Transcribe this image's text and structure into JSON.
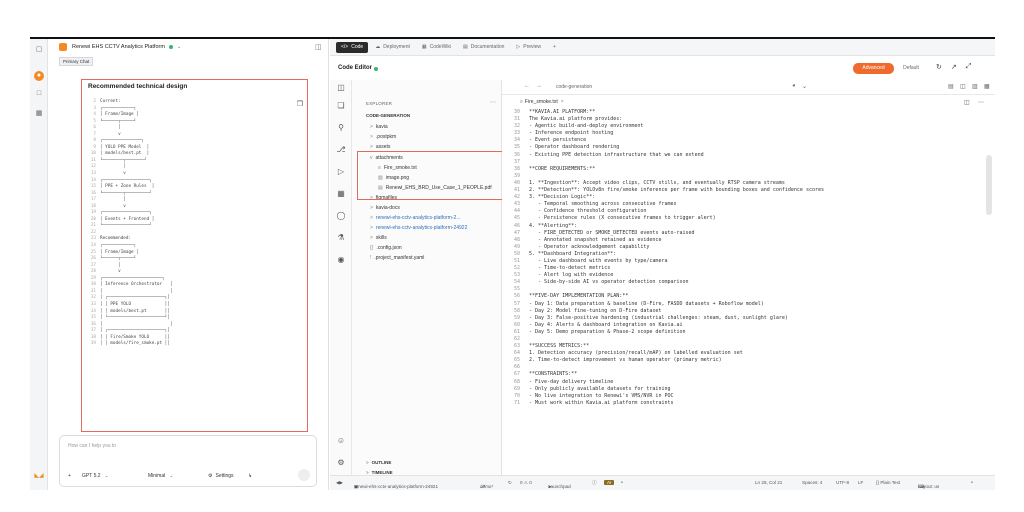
{
  "app": {
    "project_title": "Renewi EHS CCTV Analytics Platform",
    "accent": "#f28b24",
    "status_color": "#3cb371",
    "highlight_border": "#e36b5e"
  },
  "rail": {
    "icons": [
      "box-icon",
      "orange-circle-icon",
      "chat-icon",
      "grid-icon"
    ],
    "brand_glyph": "◣◢"
  },
  "chat": {
    "active_tab": "Primary Chat",
    "doc_title": "Recommended technical design",
    "doc_lines": [
      {
        "n": "2",
        "t": "Current:"
      },
      {
        "n": "3",
        "t": "┌────────────┐"
      },
      {
        "n": "4",
        "t": "│ Frame/Image │"
      },
      {
        "n": "5",
        "t": "└──────┬─────┘"
      },
      {
        "n": "6",
        "t": "       │"
      },
      {
        "n": "7",
        "t": "       v"
      },
      {
        "n": "8",
        "t": "┌───────────────┐"
      },
      {
        "n": "9",
        "t": "│ YOLO PPE Model  │"
      },
      {
        "n": "10",
        "t": "│ models/best.pt  │"
      },
      {
        "n": "11",
        "t": "└────────┬───────┘"
      },
      {
        "n": "12",
        "t": "         │"
      },
      {
        "n": "13",
        "t": "         v"
      },
      {
        "n": "14",
        "t": "┌──────────────────┐"
      },
      {
        "n": "15",
        "t": "│ PPE + Zone Rules  │"
      },
      {
        "n": "16",
        "t": "└────────┬─────────┘"
      },
      {
        "n": "17",
        "t": "         │"
      },
      {
        "n": "18",
        "t": "         v"
      },
      {
        "n": "19",
        "t": "┌──────────────────┐"
      },
      {
        "n": "20",
        "t": "│ Events + Frontend │"
      },
      {
        "n": "21",
        "t": "└──────────────────┘"
      },
      {
        "n": "22",
        "t": ""
      },
      {
        "n": "23",
        "t": "Recommended:"
      },
      {
        "n": "24",
        "t": "┌────────────┐"
      },
      {
        "n": "25",
        "t": "│ Frame/Image │"
      },
      {
        "n": "26",
        "t": "└──────┬─────┘"
      },
      {
        "n": "27",
        "t": "       │"
      },
      {
        "n": "28",
        "t": "       v"
      },
      {
        "n": "29",
        "t": "┌───────────────────────┐"
      },
      {
        "n": "30",
        "t": "│ Inference Orchestrator   │"
      },
      {
        "n": "31",
        "t": "│                          │"
      },
      {
        "n": "32",
        "t": "│ ┌──────────────────────┐│"
      },
      {
        "n": "33",
        "t": "│ │ PPE YOLO             ││"
      },
      {
        "n": "34",
        "t": "│ │ models/best.pt       ││"
      },
      {
        "n": "35",
        "t": "│ └──────────────────────┘│"
      },
      {
        "n": "36",
        "t": "│                          │"
      },
      {
        "n": "37",
        "t": "│ ┌──────────────────────┐│"
      },
      {
        "n": "38",
        "t": "│ │ Fire/Smoke YOLO      ││"
      },
      {
        "n": "39",
        "t": "│ │ models/fire_smoke.pt ││"
      }
    ],
    "input_placeholder": "How can I help you to",
    "model": "GPT 5.2",
    "mode": "Minimal",
    "settings_label": "Settings"
  },
  "tabs": [
    {
      "icon": "</>",
      "label": "Code",
      "active": true
    },
    {
      "icon": "☁",
      "label": "Deployment",
      "active": false
    },
    {
      "icon": "▦",
      "label": "CodeWiki",
      "active": false
    },
    {
      "icon": "▤",
      "label": "Documentation",
      "active": false
    },
    {
      "icon": "▷",
      "label": "Preview",
      "active": false
    },
    {
      "icon": "",
      "label": "+",
      "active": false
    }
  ],
  "editor": {
    "title": "Code Editor",
    "advanced_label": "Advanced",
    "default_label": "Default",
    "path": "code-generation"
  },
  "explorer": {
    "header": "EXPLORER",
    "root": "CODE-GENERATION",
    "items": [
      {
        "chev": ">",
        "label": "kavia",
        "indent": 0
      },
      {
        "chev": ">",
        "label": ".postpkm",
        "indent": 0
      },
      {
        "chev": ">",
        "label": "assets",
        "indent": 0
      },
      {
        "chev": "v",
        "label": "attachments",
        "indent": 0
      },
      {
        "chev": "≡",
        "label": "Fire_smoke.txt",
        "indent": 1
      },
      {
        "chev": "▧",
        "label": "image.png",
        "indent": 1
      },
      {
        "chev": "▤",
        "label": "Renewi_EHS_BRD_Use_Case_1_PEOPLE.pdf",
        "indent": 1
      },
      {
        "chev": ">",
        "label": "figmafiles",
        "indent": 0
      },
      {
        "chev": ">",
        "label": "kavia-docs",
        "indent": 0
      },
      {
        "chev": ">",
        "label": "renewi-ehs-cctv-analytics-platform-2...",
        "indent": 0
      },
      {
        "chev": ">",
        "label": "renewi-ehs-cctv-analytics-platform-24922",
        "indent": 0
      },
      {
        "chev": ">",
        "label": "skills",
        "indent": 0
      },
      {
        "chev": "{}",
        "label": ".config.json",
        "indent": 0
      },
      {
        "chev": "!",
        "label": ".project_manifest.yaml",
        "indent": 0
      }
    ],
    "outline_label": "OUTLINE",
    "timeline_label": "TIMELINE"
  },
  "code_file": {
    "name": "Fire_smoke.txt",
    "lines": [
      {
        "n": "30",
        "t": "**KAVIA.AI PLATFORM:**"
      },
      {
        "n": "31",
        "t": "The Kavia.ai platform provides:"
      },
      {
        "n": "32",
        "t": "- Agentic build-and-deploy environment"
      },
      {
        "n": "33",
        "t": "- Inference endpoint hosting"
      },
      {
        "n": "34",
        "t": "- Event persistence"
      },
      {
        "n": "35",
        "t": "- Operator dashboard rendering"
      },
      {
        "n": "36",
        "t": "- Existing PPE detection infrastructure that we can extend"
      },
      {
        "n": "37",
        "t": ""
      },
      {
        "n": "38",
        "t": "**CORE REQUIREMENTS:**"
      },
      {
        "n": "39",
        "t": ""
      },
      {
        "n": "40",
        "t": "1. **Ingestion**: Accept video clips, CCTV stills, and eventually RTSP camera streams"
      },
      {
        "n": "41",
        "t": "2. **Detection**: YOLOv8n fire/smoke inference per frame with bounding boxes and confidence scores"
      },
      {
        "n": "42",
        "t": "3. **Decision Logic**:"
      },
      {
        "n": "43",
        "t": "   - Temporal smoothing across consecutive frames"
      },
      {
        "n": "44",
        "t": "   - Confidence threshold configuration"
      },
      {
        "n": "45",
        "t": "   - Persistence rules (X consecutive frames to trigger alert)"
      },
      {
        "n": "46",
        "t": "4. **Alerting**:"
      },
      {
        "n": "47",
        "t": "   - FIRE_DETECTED or SMOKE_DETECTED events auto-raised"
      },
      {
        "n": "48",
        "t": "   - Annotated snapshot retained as evidence"
      },
      {
        "n": "49",
        "t": "   - Operator acknowledgement capability"
      },
      {
        "n": "50",
        "t": "5. **Dashboard Integration**:"
      },
      {
        "n": "51",
        "t": "   - Live dashboard with events by type/camera"
      },
      {
        "n": "52",
        "t": "   - Time-to-detect metrics"
      },
      {
        "n": "53",
        "t": "   - Alert log with evidence"
      },
      {
        "n": "54",
        "t": "   - Side-by-side AI vs operator detection comparison"
      },
      {
        "n": "55",
        "t": ""
      },
      {
        "n": "56",
        "t": "**FIVE-DAY IMPLEMENTATION PLAN:**"
      },
      {
        "n": "57",
        "t": "- Day 1: Data preparation & baseline (D-Fire, FASDD datasets + Roboflow model)"
      },
      {
        "n": "58",
        "t": "- Day 2: Model fine-tuning on D-Fire dataset"
      },
      {
        "n": "59",
        "t": "- Day 3: False-positive hardening (industrial challenges: steam, dust, sunlight glare)"
      },
      {
        "n": "60",
        "t": "- Day 4: Alerts & dashboard integration on Kavia.ai"
      },
      {
        "n": "61",
        "t": "- Day 5: Demo preparation & Phase-2 scope definition"
      },
      {
        "n": "62",
        "t": ""
      },
      {
        "n": "63",
        "t": "**SUCCESS METRICS:**"
      },
      {
        "n": "64",
        "t": "1. Detection accuracy (precision/recall/mAP) on labelled evaluation set"
      },
      {
        "n": "65",
        "t": "2. Time-to-detect improvement vs human operator (primary metric)"
      },
      {
        "n": "66",
        "t": ""
      },
      {
        "n": "67",
        "t": "**CONSTRAINTS:**"
      },
      {
        "n": "68",
        "t": "- Five-day delivery timeline"
      },
      {
        "n": "69",
        "t": "- Only publicly available datasets for training"
      },
      {
        "n": "70",
        "t": "- No live integration to Renewi's VMS/NVR in POC"
      },
      {
        "n": "71",
        "t": "- Must work within Kavia.ai platform constraints"
      }
    ]
  },
  "status_bar": {
    "branch": "renewi-ehs-cctv-analytics-platform-24921",
    "demo": "demo*",
    "warnings": "0 ⚠ 0",
    "launchpad": "Launchpad",
    "ai_badge": "AI",
    "position": "Ln 25, Col 21",
    "spaces": "Spaces: 4",
    "encoding": "UTF-8",
    "eol": "LF",
    "language": "{} Plain Text",
    "layout": "Layout: us"
  }
}
